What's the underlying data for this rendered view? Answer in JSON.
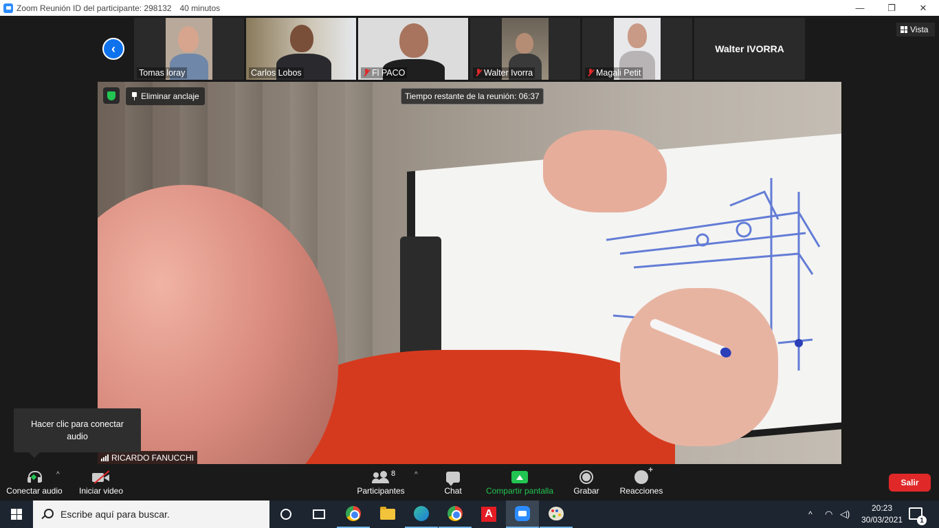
{
  "window": {
    "title": "Zoom Reunión ID del participante: 298132",
    "duration": "40 minutos",
    "controls": [
      "—",
      "❐",
      "✕"
    ]
  },
  "gallery": {
    "participants": [
      {
        "name": "Tomas loray",
        "muted": false
      },
      {
        "name": "Carlos Lobos",
        "muted": false
      },
      {
        "name": "Fl PACO",
        "muted": true
      },
      {
        "name": "Walter Ivorra",
        "muted": true
      },
      {
        "name": "Magali Petit",
        "muted": true
      }
    ],
    "name_only_tile": "Walter IVORRA",
    "view_button": "Vista"
  },
  "main_video": {
    "remove_pin_label": "Eliminar anclaje",
    "time_remaining": "Tiempo restante de la reunión: 06:37",
    "speaker_name": "RICARDO FANUCCHI"
  },
  "tooltip": {
    "text": "Hacer clic para conectar audio"
  },
  "toolbar": {
    "connect_audio": "Conectar audio",
    "start_video": "Iniciar video",
    "participants": "Participantes",
    "participants_count": "8",
    "chat": "Chat",
    "share_screen": "Compartir pantalla",
    "record": "Grabar",
    "reactions": "Reacciones",
    "leave": "Salir",
    "caret": "^"
  },
  "taskbar": {
    "search_placeholder": "Escribe aquí para buscar.",
    "time": "20:23",
    "date": "30/03/2021",
    "notification_count": "1",
    "tray_caret": "^"
  },
  "colors": {
    "zoom_blue": "#0e72ed",
    "share_green": "#23c552",
    "leave_red": "#e02828",
    "background": "#1a1a1a",
    "taskbar": "#1c2530"
  }
}
